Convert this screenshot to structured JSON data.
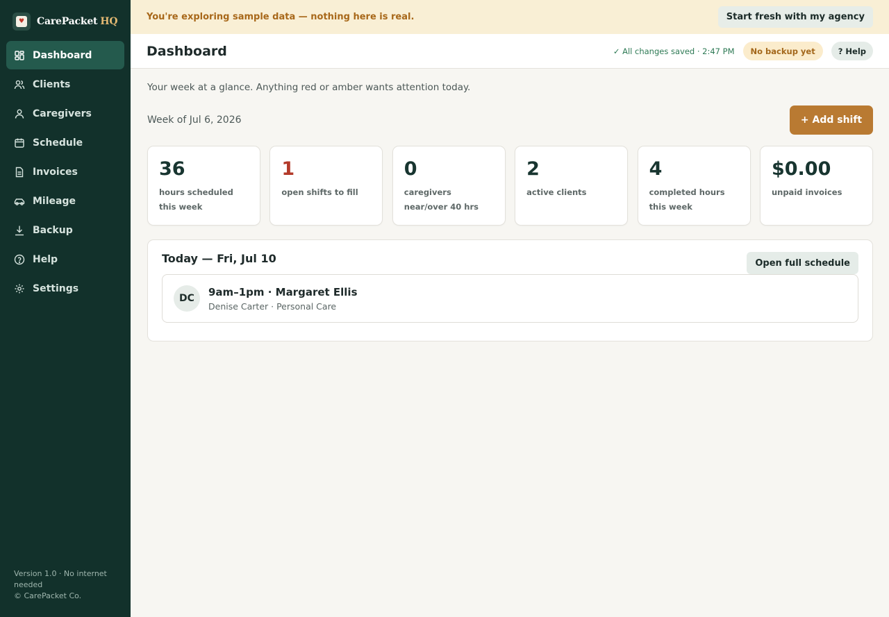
{
  "brand": {
    "name": "CarePacket",
    "suffix": "HQ"
  },
  "sidebar": {
    "items": [
      {
        "label": "Dashboard",
        "icon": "grid-icon",
        "active": true
      },
      {
        "label": "Clients",
        "icon": "users-icon"
      },
      {
        "label": "Caregivers",
        "icon": "person-icon"
      },
      {
        "label": "Schedule",
        "icon": "calendar-icon"
      },
      {
        "label": "Invoices",
        "icon": "document-icon"
      },
      {
        "label": "Mileage",
        "icon": "car-icon"
      },
      {
        "label": "Backup",
        "icon": "download-icon"
      },
      {
        "label": "Help",
        "icon": "help-circle-icon"
      },
      {
        "label": "Settings",
        "icon": "gear-icon"
      }
    ],
    "footer": {
      "version": "Version 1.0 · No internet needed",
      "copyright": "© CarePacket Co."
    }
  },
  "banner": {
    "text": "You're exploring sample data — nothing here is real.",
    "button": "Start fresh with my agency"
  },
  "header": {
    "title": "Dashboard",
    "saved": "✓ All changes saved · 2:47 PM",
    "backup_badge": "No backup yet",
    "help": "? Help"
  },
  "main": {
    "intro": "Your week at a glance. Anything red or amber wants attention today.",
    "week_label": "Week of Jul 6, 2026",
    "add_shift": "+ Add shift",
    "stats": [
      {
        "value": "36",
        "label": "hours scheduled this week"
      },
      {
        "value": "1",
        "label": "open shifts to fill",
        "alert": true
      },
      {
        "value": "0",
        "label": "caregivers near/over 40 hrs"
      },
      {
        "value": "2",
        "label": "active clients"
      },
      {
        "value": "4",
        "label": "completed hours this week"
      },
      {
        "value": "$0.00",
        "label": "unpaid invoices"
      }
    ],
    "today": {
      "title": "Today — Fri, Jul 10",
      "button": "Open full schedule",
      "shifts": [
        {
          "initials": "DC",
          "title": "9am–1pm · Margaret Ellis",
          "subtitle": "Denise Carter · Personal Care"
        }
      ]
    }
  },
  "colors": {
    "sidebar": "#12312b",
    "sidebar_active": "#245a4d",
    "accent": "#b97a32",
    "banner_bg": "#f9efd5",
    "banner_text": "#a8681a",
    "alert": "#b33a2a",
    "saved": "#2e7a55"
  }
}
